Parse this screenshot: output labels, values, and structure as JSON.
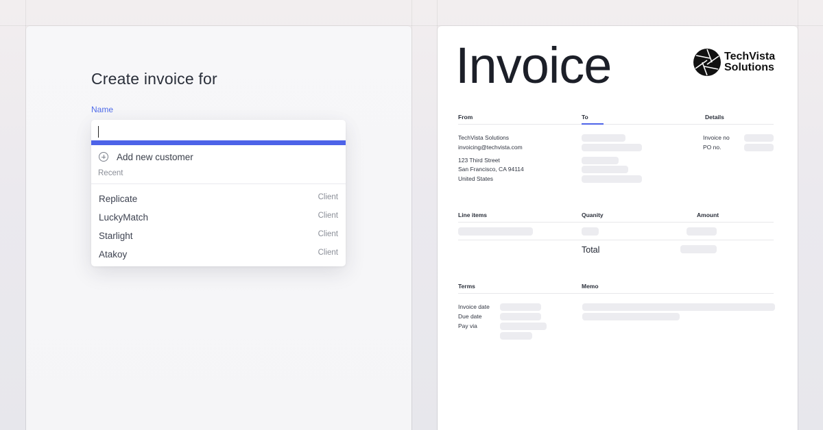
{
  "left": {
    "heading": "Create invoice for",
    "name_label": "Name",
    "input_value": "",
    "add_new_label": "Add new customer",
    "recent_label": "Recent",
    "customers": [
      {
        "name": "Replicate",
        "tag": "Client"
      },
      {
        "name": "LuckyMatch",
        "tag": "Client"
      },
      {
        "name": "Starlight",
        "tag": "Client"
      },
      {
        "name": "Atakoy",
        "tag": "Client"
      }
    ]
  },
  "invoice": {
    "title": "Invoice",
    "brand_line1": "TechVista",
    "brand_line2": "Solutions",
    "headers": {
      "from": "From",
      "to": "To",
      "details": "Details"
    },
    "from": {
      "company": "TechVista Solutions",
      "email": "invoicing@techvista.com",
      "street": "123 Third Street",
      "city": "San Francisco, CA 94114",
      "country": "United States"
    },
    "details": {
      "invoice_no": "Invoice no",
      "po_no": "PO no."
    },
    "line_headers": {
      "items": "Line items",
      "quantity": "Quanity",
      "amount": "Amount"
    },
    "total_label": "Total",
    "terms_header": "Terms",
    "memo_header": "Memo",
    "terms": {
      "invoice_date": "Invoice date",
      "due_date": "Due date",
      "pay_via": "Pay via"
    }
  },
  "colors": {
    "accent": "#4d63e8",
    "placeholder": "#ececf0"
  }
}
